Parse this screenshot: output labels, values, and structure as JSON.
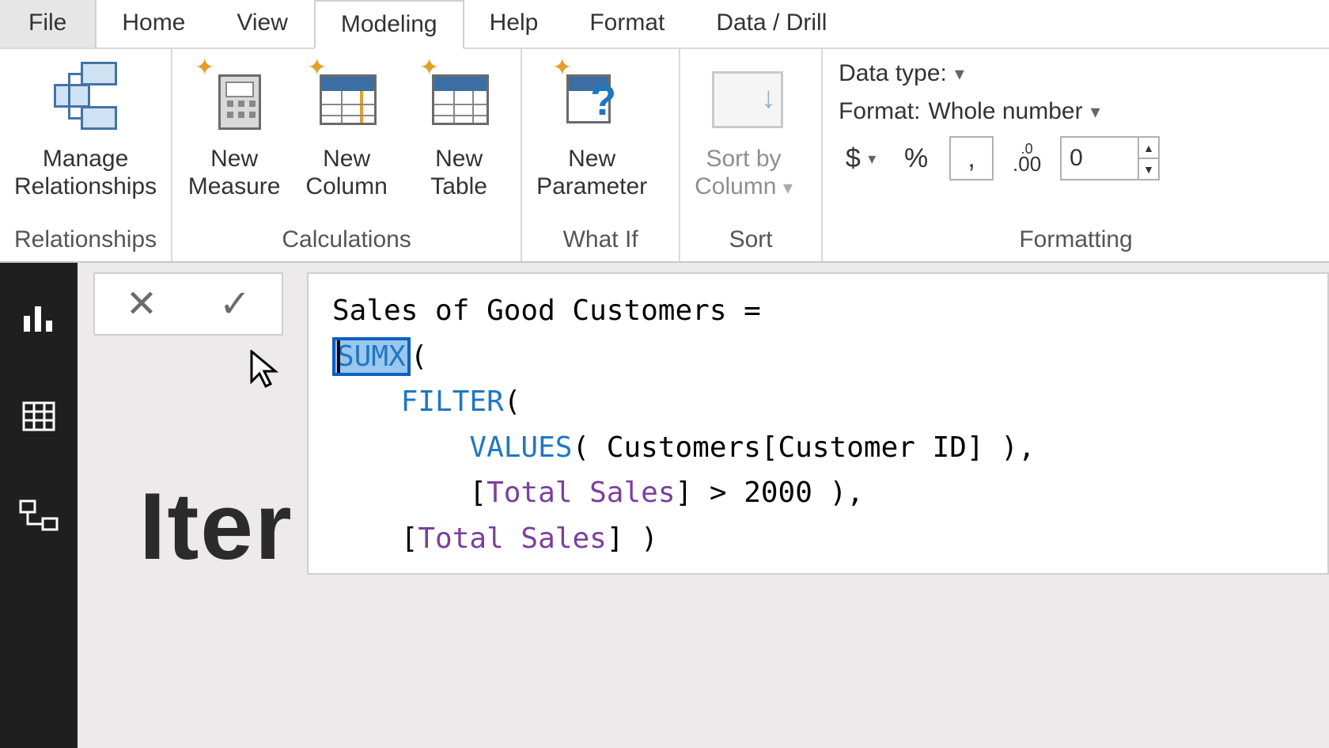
{
  "tabs": {
    "file": "File",
    "home": "Home",
    "view": "View",
    "modeling": "Modeling",
    "help": "Help",
    "format": "Format",
    "drill": "Data / Drill",
    "active": "modeling"
  },
  "ribbon": {
    "relationships": {
      "label": "Relationships",
      "manage": "Manage\nRelationships"
    },
    "calculations": {
      "label": "Calculations",
      "measure": "New\nMeasure",
      "column": "New\nColumn",
      "table": "New\nTable"
    },
    "whatif": {
      "label": "What If",
      "param": "New\nParameter"
    },
    "sort": {
      "label": "Sort",
      "sortby": "Sort by\nColumn"
    },
    "formatting": {
      "label": "Formatting",
      "datatype_label": "Data type:",
      "format_label": "Format:",
      "format_value": "Whole number",
      "currency": "$",
      "percent": "%",
      "comma": ",",
      "decimals_icon": ".00",
      "decimals_value": "0"
    }
  },
  "formula": {
    "line1_name": "Sales of Good Customers",
    "sumx": "SUMX",
    "filter": "FILTER",
    "values": "VALUES",
    "arg1": " Customers[Customer ID] ),",
    "measure": "Total Sales",
    "gt": " > 2000 ),",
    "close": " )"
  },
  "canvas": {
    "heading": "Iter"
  }
}
